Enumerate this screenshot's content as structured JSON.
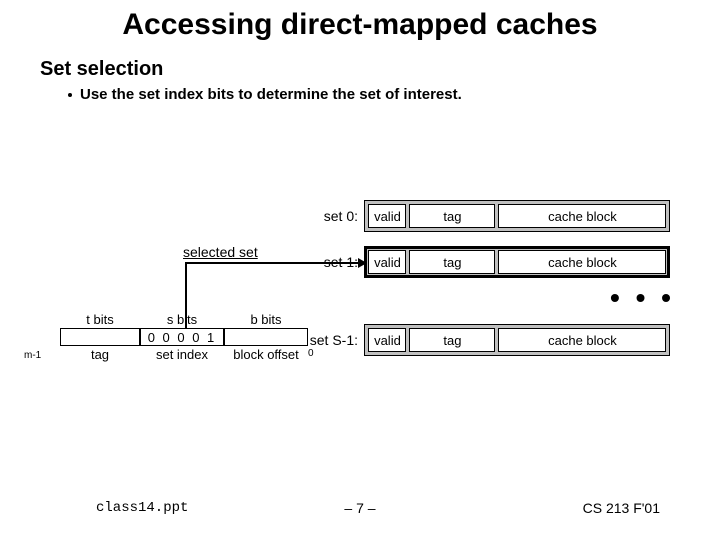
{
  "title": "Accessing direct-mapped caches",
  "heading": "Set selection",
  "bullet": "Use the set index bits to determine the set of interest.",
  "selected_label": "selected set",
  "ellipsis": "• • •",
  "rows": [
    {
      "label": "set 0:",
      "valid": "valid",
      "tag": "tag",
      "block": "cache block"
    },
    {
      "label": "set 1:",
      "valid": "valid",
      "tag": "tag",
      "block": "cache block"
    },
    {
      "label": "set S-1:",
      "valid": "valid",
      "tag": "tag",
      "block": "cache block"
    }
  ],
  "addr": {
    "headers": {
      "t": "t bits",
      "s": "s bits",
      "b": "b bits"
    },
    "values": {
      "t": "",
      "s": "0 0  0 0 1",
      "b": ""
    },
    "below": {
      "t": "tag",
      "s": "set index",
      "b": "block offset"
    },
    "m_label": "m-1",
    "zero_label": "0"
  },
  "footer": {
    "left": "class14.ppt",
    "center": "– 7 –",
    "right": "CS 213 F'01"
  }
}
